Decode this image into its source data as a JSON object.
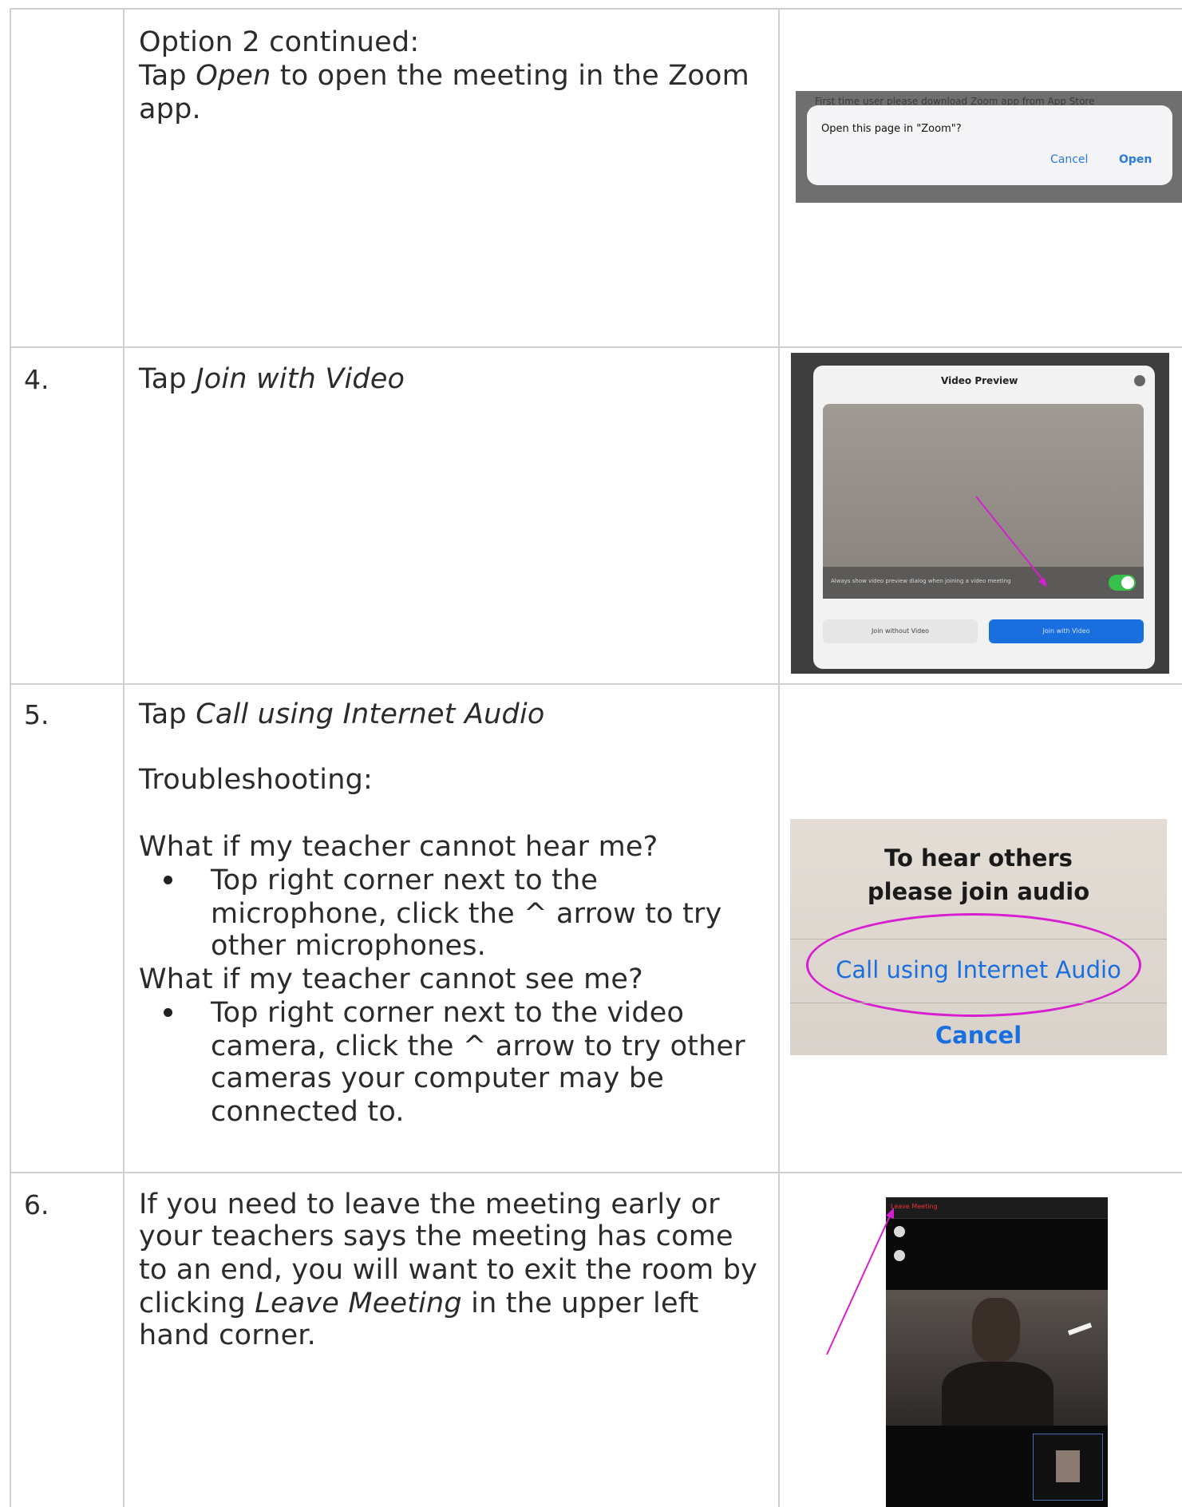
{
  "rows": [
    {
      "number": "",
      "lines": [
        "Option 2 continued:",
        "Tap ",
        "Open",
        " to open the meeting in the Zoom",
        "app."
      ],
      "screenshot": {
        "banner": "First time user please download Zoom app from App Store",
        "dialog_title": "Open this page in \"Zoom\"?",
        "cancel": "Cancel",
        "open": "Open"
      }
    },
    {
      "number": "4.",
      "prefix": "Tap ",
      "em": "Join with Video",
      "screenshot": {
        "title": "Video Preview",
        "toggle_text": "Always show video preview dialog when joining a video meeting",
        "btn_left": "Join without Video",
        "btn_right": "Join with Video"
      }
    },
    {
      "number": "5.",
      "prefix": "Tap ",
      "em": "Call using Internet Audio",
      "troubleshooting": "Troubleshooting:",
      "q1": "What if my teacher cannot hear me?",
      "b1": [
        "Top right corner next to the",
        "microphone, click the ^ arrow to try",
        "other microphones."
      ],
      "q2": "What if my teacher cannot see me?",
      "b2": [
        "Top right corner next to the video",
        "camera, click the ^ arrow to try other",
        "cameras your computer may be",
        "connected to."
      ],
      "screenshot": {
        "title1": "To hear others",
        "title2": "please join audio",
        "option": "Call using Internet Audio",
        "cancel": "Cancel"
      }
    },
    {
      "number": "6.",
      "lines": [
        "If you need to leave the meeting early or",
        "your teachers says the meeting has come",
        "to an end, you will want to exit the room by",
        "clicking ",
        "Leave Meeting",
        " in the upper left",
        "hand corner."
      ],
      "screenshot": {
        "leave": "Leave Meeting"
      }
    }
  ],
  "colors": {
    "accent_arrow": "#d81fd0",
    "ios_blue": "#1a6fe0"
  }
}
